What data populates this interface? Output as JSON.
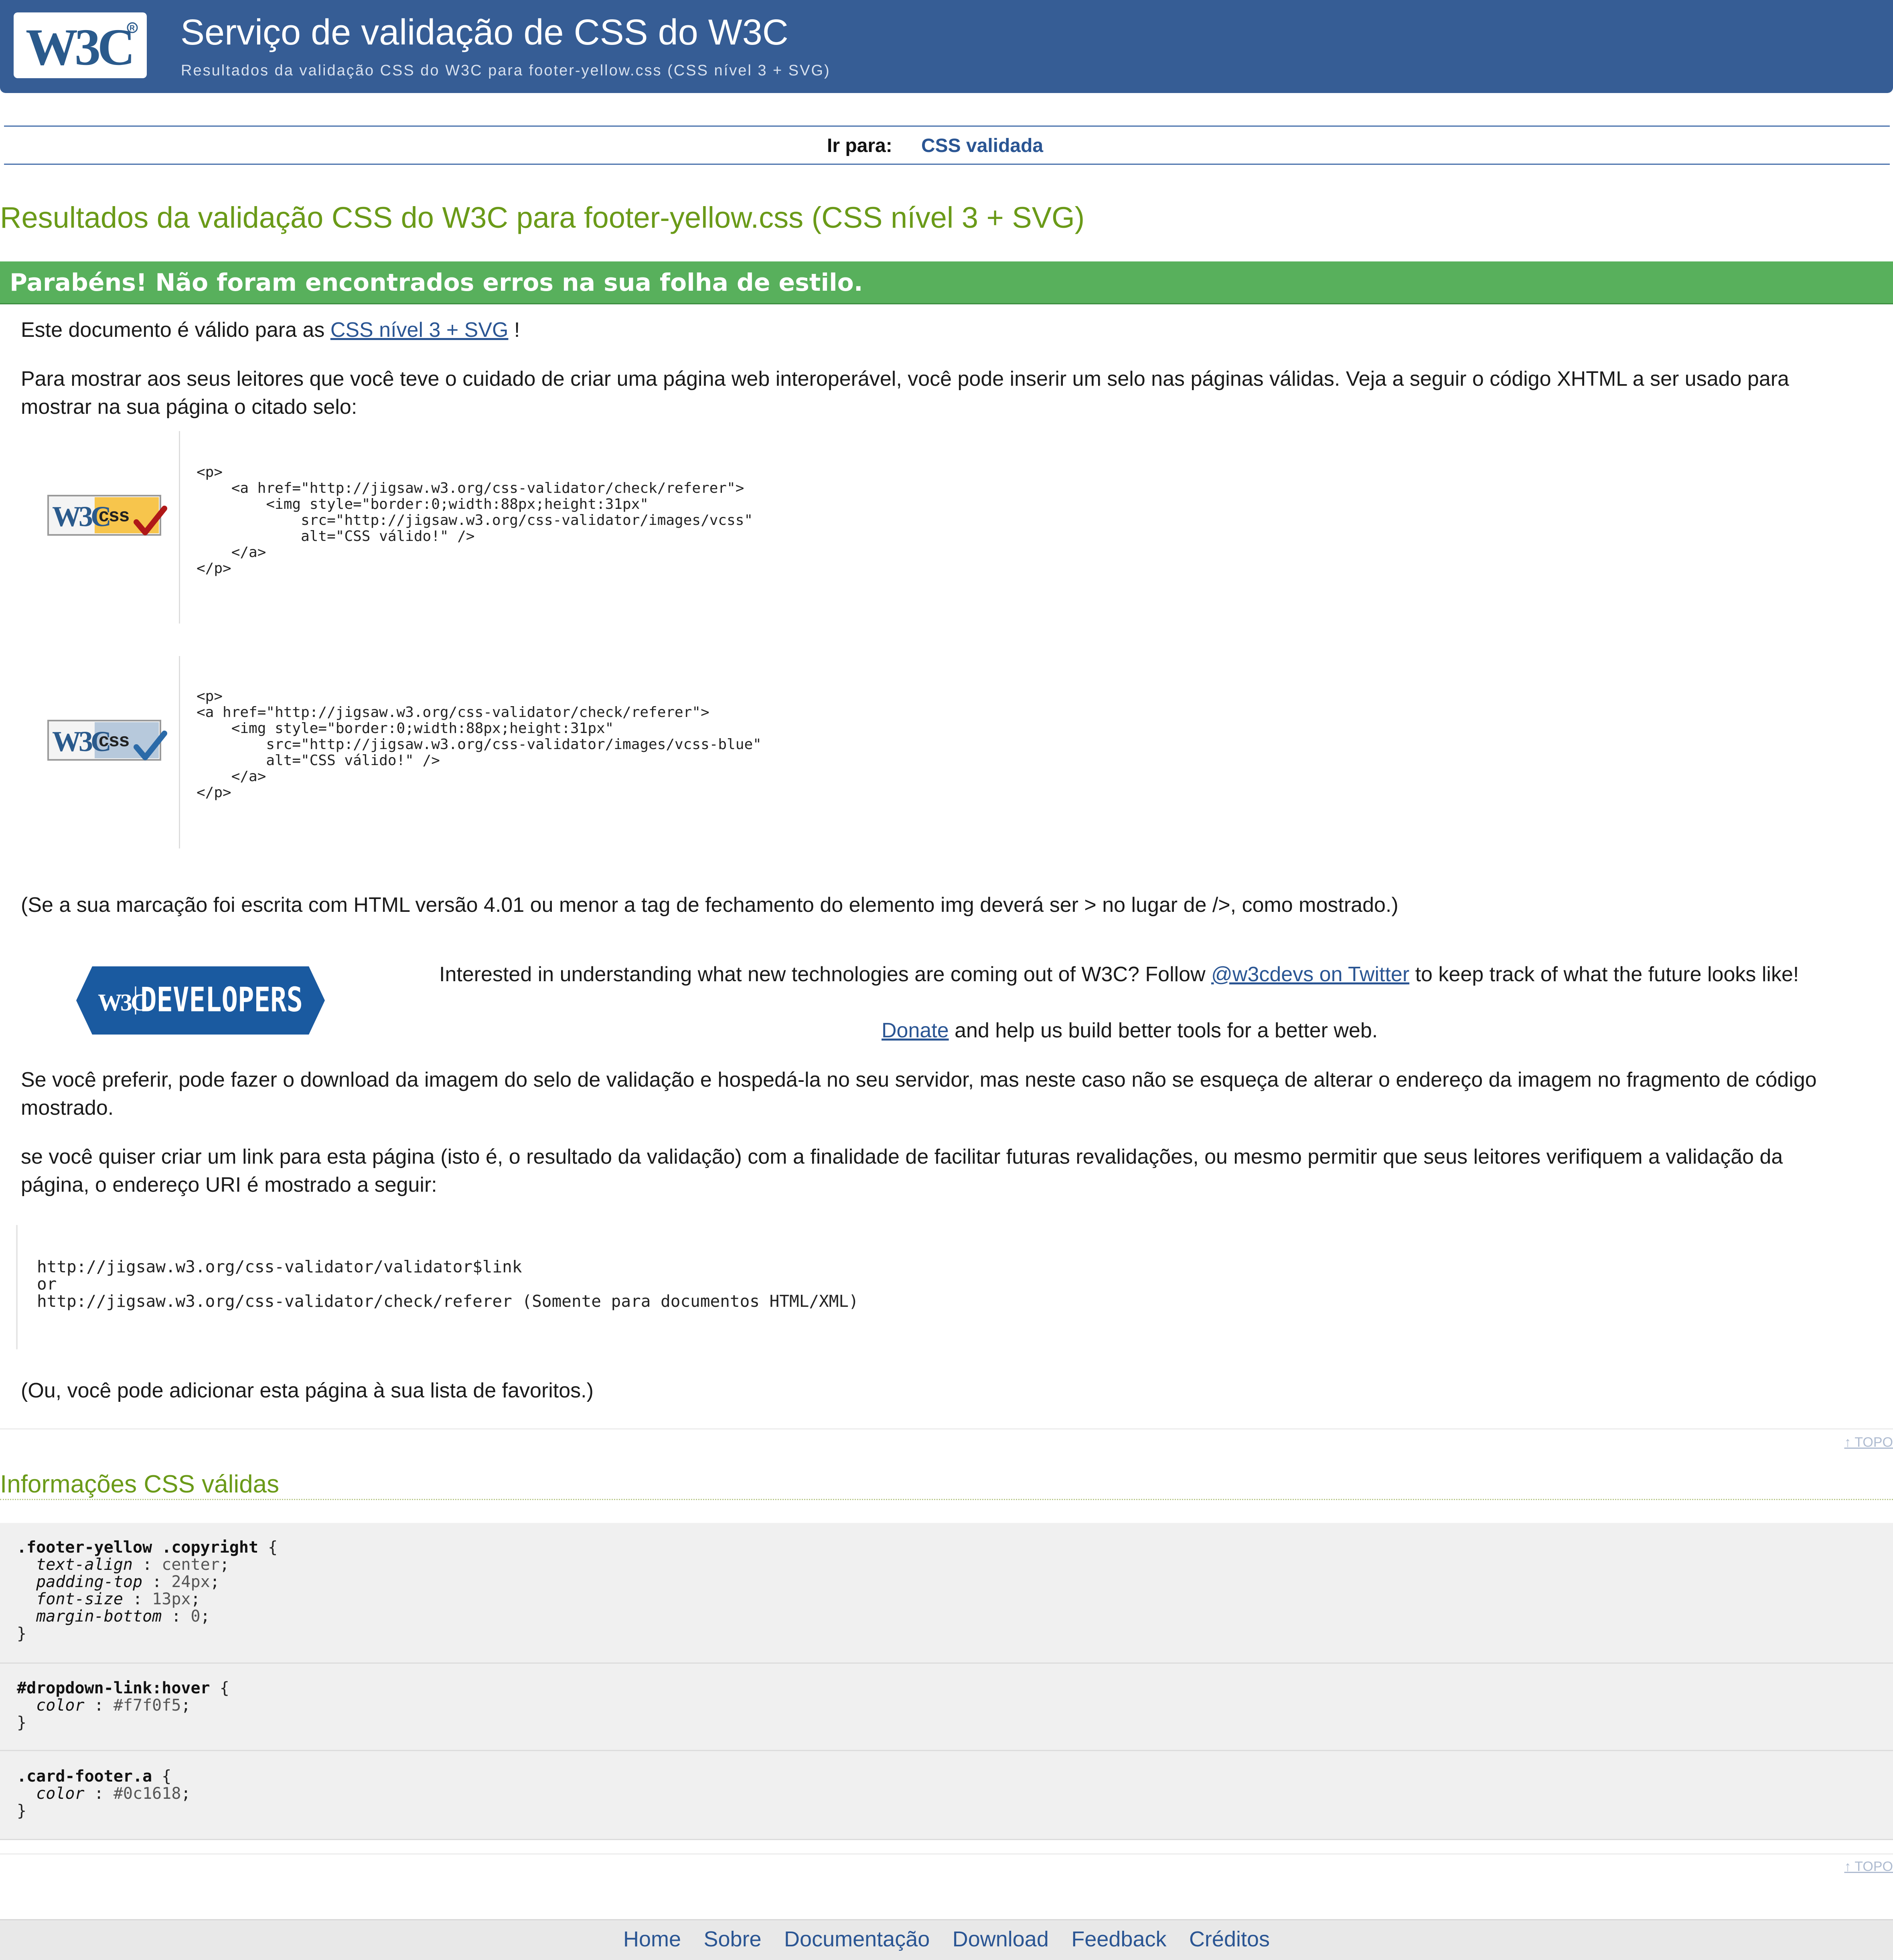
{
  "header": {
    "logo_text": "W3C",
    "title": "Serviço de validação de CSS do W3C",
    "subtitle": "Resultados da validação CSS do W3C para footer-yellow.css (CSS nível 3 + SVG)"
  },
  "jump": {
    "label": "Ir para:",
    "link": "CSS validada"
  },
  "results": {
    "title": "Resultados da validação CSS do W3C para footer-yellow.css (CSS nível 3 + SVG)",
    "congrats": "Parabéns! Não foram encontrados erros na sua folha de estilo.",
    "valid_prefix": "Este documento é válido para as",
    "valid_link": "CSS nível 3 + SVG",
    "valid_suffix": "!",
    "badge_intro_line1": "Para mostrar aos seus leitores que você teve o cuidado de criar uma página web interoperável, você pode inserir um selo nas páginas válidas. Veja a seguir o código XHTML a ser usado para",
    "badge_intro_line2": "mostrar na sua página o citado selo:",
    "badge1_code": "<p>\n    <a href=\"http://jigsaw.w3.org/css-validator/check/referer\">\n        <img style=\"border:0;width:88px;height:31px\"\n            src=\"http://jigsaw.w3.org/css-validator/images/vcss\"\n            alt=\"CSS válido!\" />\n    </a>\n</p>",
    "badge2_code": "<p>\n<a href=\"http://jigsaw.w3.org/css-validator/check/referer\">\n    <img style=\"border:0;width:88px;height:31px\"\n        src=\"http://jigsaw.w3.org/css-validator/images/vcss-blue\"\n        alt=\"CSS válido!\" />\n    </a>\n</p>",
    "badge_text": "css",
    "html401_note": "(Se a sua marcação foi escrita com HTML versão 4.01 ou menor a tag de fechamento do elemento img deverá ser > no lugar de />, como mostrado.)",
    "dev_banner_text": "DEVELOPERS",
    "dev_prefix": "Interested in understanding what new technologies are coming out of W3C? Follow",
    "dev_link": "@w3cdevs on Twitter",
    "dev_suffix": "to keep track of what the future looks like!",
    "donate_link": "Donate",
    "donate_suffix": "and help us build better tools for a better web.",
    "download_line1": "Se você preferir, pode fazer o download da imagem do selo de validação e hospedá-la no seu servidor, mas neste caso não se esqueça de alterar o endereço da imagem no fragmento de código",
    "download_line2": "mostrado.",
    "link_line1": "se você quiser criar um link para esta página (isto é, o resultado da validação) com a finalidade de facilitar futuras revalidações, ou mesmo permitir que seus leitores verifiquem a validação da",
    "link_line2": "página, o endereço URI é mostrado a seguir:",
    "uri_code": "http://jigsaw.w3.org/css-validator/validator$link\nor\nhttp://jigsaw.w3.org/css-validator/check/referer (Somente para documentos HTML/XML)",
    "bookmark": "(Ou, você pode adicionar esta página à sua lista de favoritos.)",
    "topo": "↑ TOPO"
  },
  "info": {
    "title": "Informações CSS válidas",
    "rules": [
      {
        "selector": ".footer-yellow .copyright",
        "declarations": [
          {
            "prop": "text-align",
            "value": "center"
          },
          {
            "prop": "padding-top",
            "value": "24px"
          },
          {
            "prop": "font-size",
            "value": "13px"
          },
          {
            "prop": "margin-bottom",
            "value": "0"
          }
        ]
      },
      {
        "selector": "#dropdown-link:hover",
        "declarations": [
          {
            "prop": "color",
            "value": "#f7f0f5"
          }
        ]
      },
      {
        "selector": ".card-footer.a",
        "declarations": [
          {
            "prop": "color",
            "value": "#0c1618"
          }
        ]
      }
    ]
  },
  "footer": {
    "links": [
      "Home",
      "Sobre",
      "Documentação",
      "Download",
      "Feedback",
      "Créditos"
    ]
  },
  "colors": {
    "header_bg": "#365d95",
    "green_title": "#6a9a18",
    "congrats_bg": "#58b05c",
    "link": "#2a5593"
  }
}
